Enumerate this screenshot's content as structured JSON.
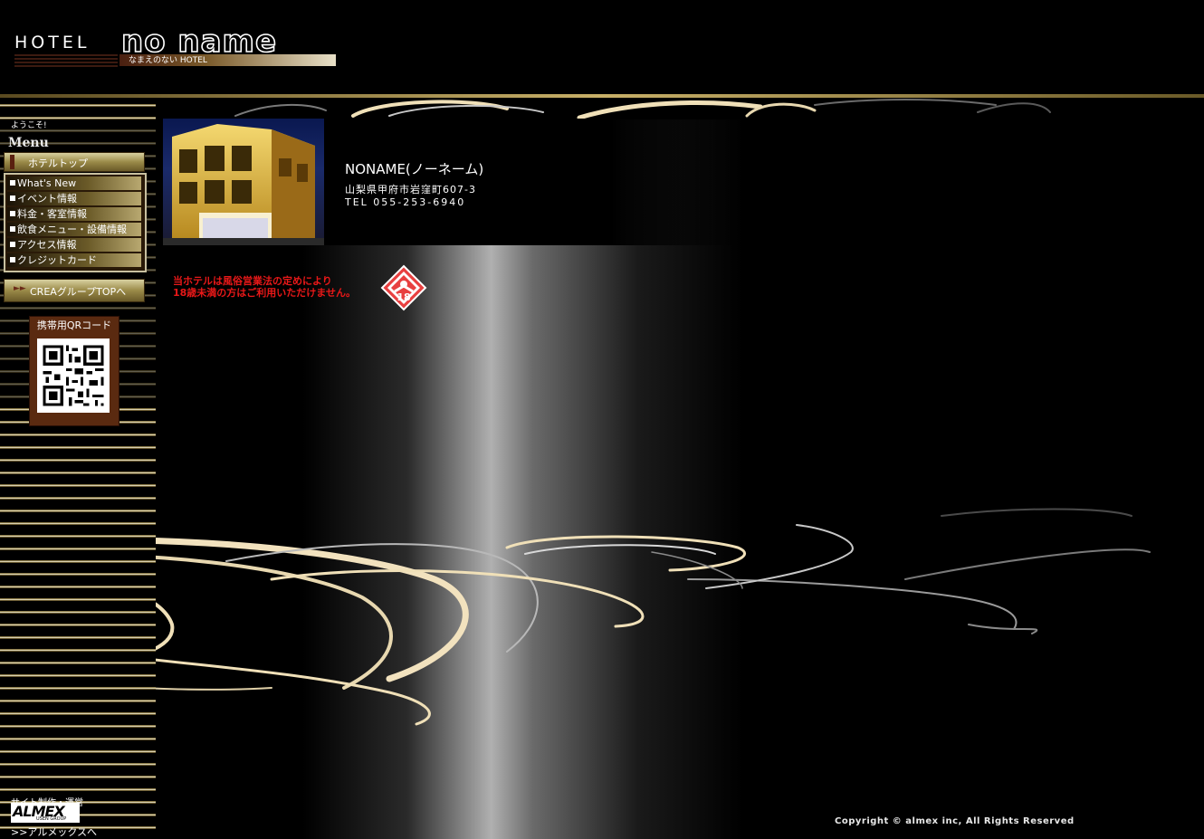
{
  "header": {
    "logo_hotel": "HOTEL",
    "logo_name": "no name",
    "logo_subtitle": "なまえのない HOTEL"
  },
  "sidebar": {
    "welcome": "ようこそ!",
    "menu_title": "Menu",
    "top_button": "ホテルトップ",
    "items": [
      {
        "label": "What's New"
      },
      {
        "label": "イベント情報"
      },
      {
        "label": "料金・客室情報"
      },
      {
        "label": "飲食メニュー・設備情報"
      },
      {
        "label": "アクセス情報"
      },
      {
        "label": "クレジットカード"
      }
    ],
    "crea_button": "CREAグループTOPへ",
    "qr_title": "携帯用QRコード",
    "credit_label": "サイト制作・運営",
    "almex_logo": "ALMEX",
    "almex_logo_sub": "USEN GROUP",
    "almex_link": ">>アルメックスへ"
  },
  "hotel": {
    "name": "NONAME(ノーネーム)",
    "address": "山梨県甲府市岩窪町607-3",
    "tel": "TEL 055-253-6940"
  },
  "notice": {
    "line1": "当ホテルは風俗営業法の定めにより",
    "line2": "18歳未満の方はご利用いただけません。",
    "badge": "18"
  },
  "footer": {
    "copyright": "Copyright © almex inc, All Rights Reserved"
  },
  "colors": {
    "gold": "#c8b068",
    "notice_red": "#e81818",
    "qr_frame": "#5a2a10"
  }
}
